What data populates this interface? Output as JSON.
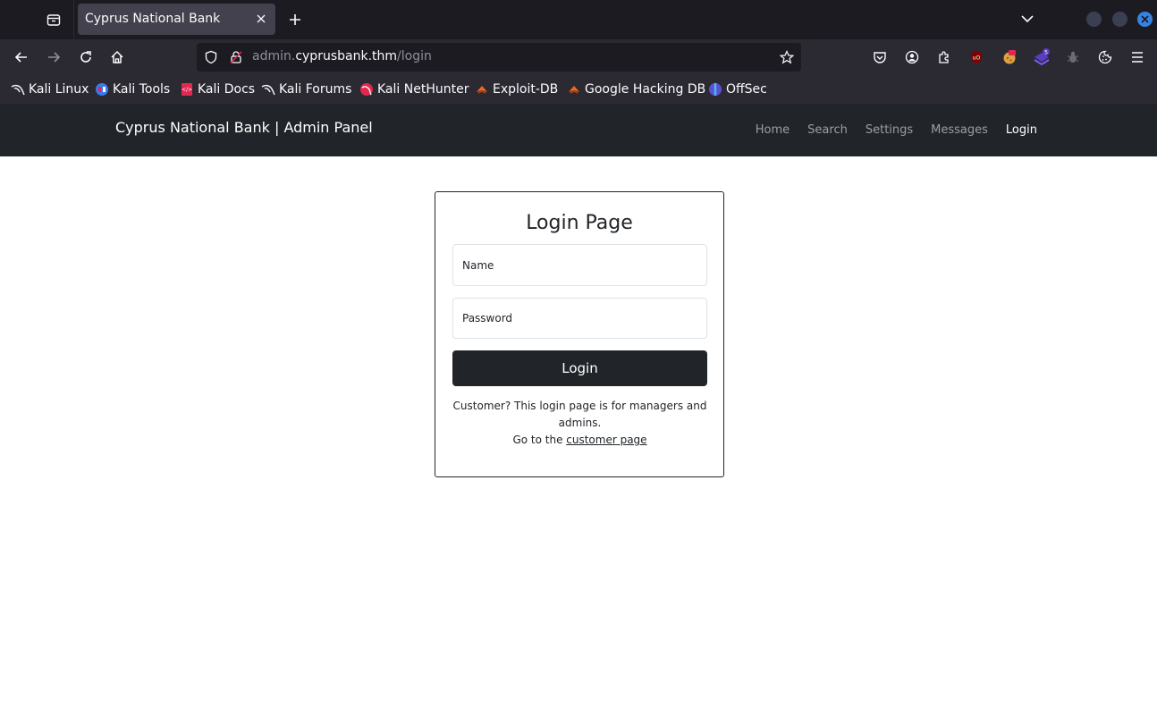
{
  "browser": {
    "tab_title": "Cyprus National Bank",
    "url_prefix": "admin.",
    "url_host": "cyprusbank.thm",
    "url_path": "/login",
    "extension_badge": "5",
    "bookmarks": [
      {
        "label": "Kali Linux",
        "icon": "kali-dragon-icon"
      },
      {
        "label": "Kali Tools",
        "icon": "kali-tools-icon"
      },
      {
        "label": "Kali Docs",
        "icon": "kali-docs-icon"
      },
      {
        "label": "Kali Forums",
        "icon": "kali-dragon-icon"
      },
      {
        "label": "Kali NetHunter",
        "icon": "nethunter-icon"
      },
      {
        "label": "Exploit-DB",
        "icon": "exploit-db-icon"
      },
      {
        "label": "Google Hacking DB",
        "icon": "ghdb-icon"
      },
      {
        "label": "OffSec",
        "icon": "offsec-icon"
      }
    ]
  },
  "site": {
    "brand": "Cyprus National Bank | Admin Panel",
    "nav": [
      {
        "label": "Home",
        "active": false
      },
      {
        "label": "Search",
        "active": false
      },
      {
        "label": "Settings",
        "active": false
      },
      {
        "label": "Messages",
        "active": false
      },
      {
        "label": "Login",
        "active": true
      }
    ]
  },
  "login": {
    "title": "Login Page",
    "name_placeholder": "Name",
    "password_placeholder": "Password",
    "button_label": "Login",
    "note_line1": "Customer? This login page is for managers and admins.",
    "note_goto": "Go to the ",
    "note_link": "customer page"
  },
  "colors": {
    "chrome_dark": "#1c1b22",
    "chrome_mid": "#2b2a33",
    "site_nav": "#212529",
    "accent_close": "#3584e4"
  }
}
